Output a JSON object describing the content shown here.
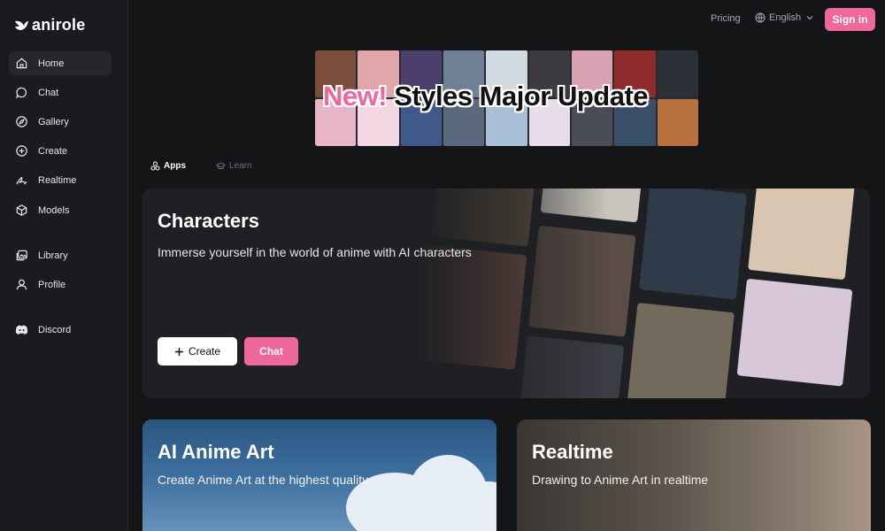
{
  "app": {
    "logo_text": "anirole"
  },
  "sidebar": {
    "items": [
      {
        "label": "Home",
        "icon": "home-icon",
        "active": true
      },
      {
        "label": "Chat",
        "icon": "chat-icon"
      },
      {
        "label": "Gallery",
        "icon": "compass-icon"
      },
      {
        "label": "Create",
        "icon": "plus-square-icon"
      },
      {
        "label": "Realtime",
        "icon": "brush-icon"
      },
      {
        "label": "Models",
        "icon": "cube-icon"
      },
      {
        "label": "Library",
        "icon": "images-icon"
      },
      {
        "label": "Profile",
        "icon": "user-icon"
      },
      {
        "label": "Discord",
        "icon": "discord-icon"
      }
    ]
  },
  "topbar": {
    "pricing": "Pricing",
    "language": "English",
    "signin": "Sign in"
  },
  "banner": {
    "highlight": "New!",
    "text": "Styles Major Update"
  },
  "tabs": [
    {
      "label": "Apps",
      "icon": "apps-icon",
      "active": true
    },
    {
      "label": "Learn",
      "icon": "graduation-cap-icon",
      "active": false
    }
  ],
  "characters_card": {
    "title": "Characters",
    "description": "Immerse yourself in the world of anime with AI characters",
    "create_label": "Create",
    "chat_label": "Chat"
  },
  "art_card": {
    "title": "AI Anime Art",
    "description": "Create Anime Art at the highest quality"
  },
  "realtime_card": {
    "title": "Realtime",
    "description": "Drawing to Anime Art in realtime"
  },
  "colors": {
    "accent": "#f0679a",
    "background": "#141517",
    "sidebar": "#1a1b1e",
    "card": "#1f2023"
  }
}
